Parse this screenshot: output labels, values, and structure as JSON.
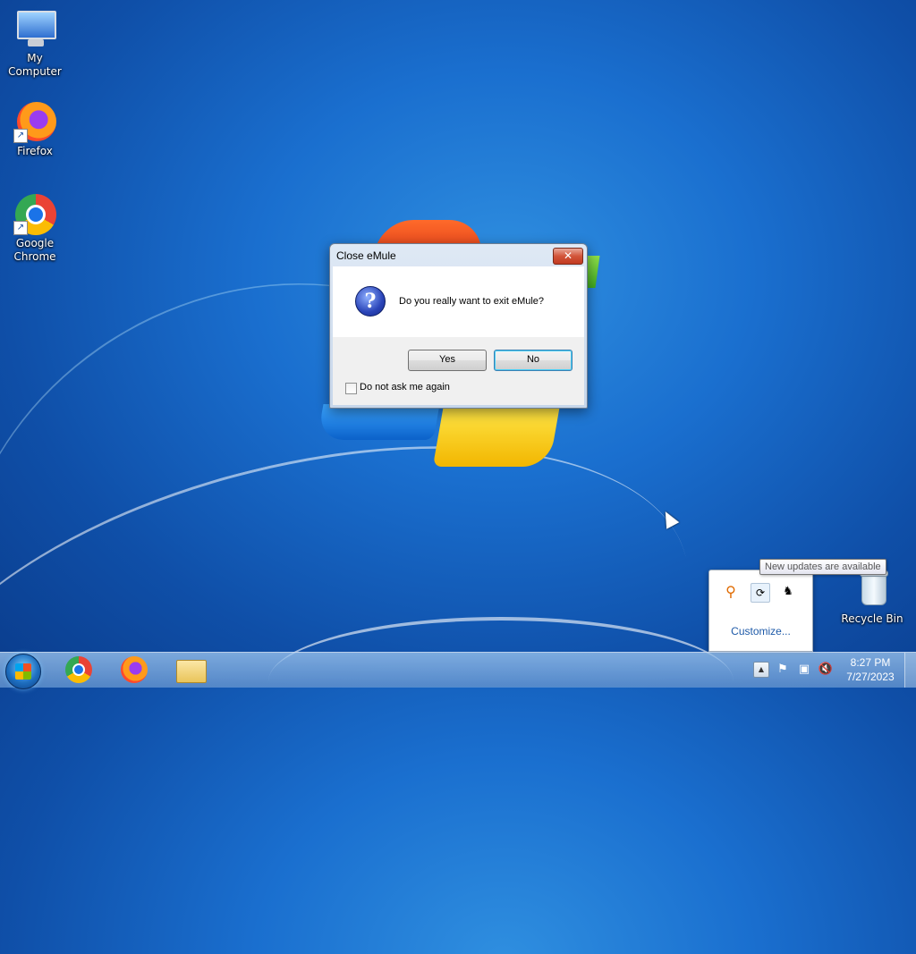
{
  "desktop": {
    "icons": [
      {
        "label": "My Computer"
      },
      {
        "label": "Firefox"
      },
      {
        "label": "Google Chrome"
      },
      {
        "label": "Recycle Bin"
      }
    ]
  },
  "dialog": {
    "title": "Close eMule",
    "close_glyph": "✕",
    "message": "Do you really want to exit eMule?",
    "icon": "question-icon",
    "yes_label": "Yes",
    "no_label": "No",
    "checkbox_label": "Do not ask me again",
    "checkbox_checked": false
  },
  "tray_popup": {
    "tooltip": "New updates are available",
    "customize_label": "Customize...",
    "icons": [
      "search-icon",
      "update-icon",
      "emule-icon"
    ]
  },
  "taskbar": {
    "pinned": [
      "chrome",
      "firefox",
      "explorer"
    ],
    "tray_icons": [
      "action-center-flag-icon",
      "network-icon",
      "volume-muted-icon"
    ],
    "clock_time": "8:27 PM",
    "clock_date": "7/27/2023"
  }
}
